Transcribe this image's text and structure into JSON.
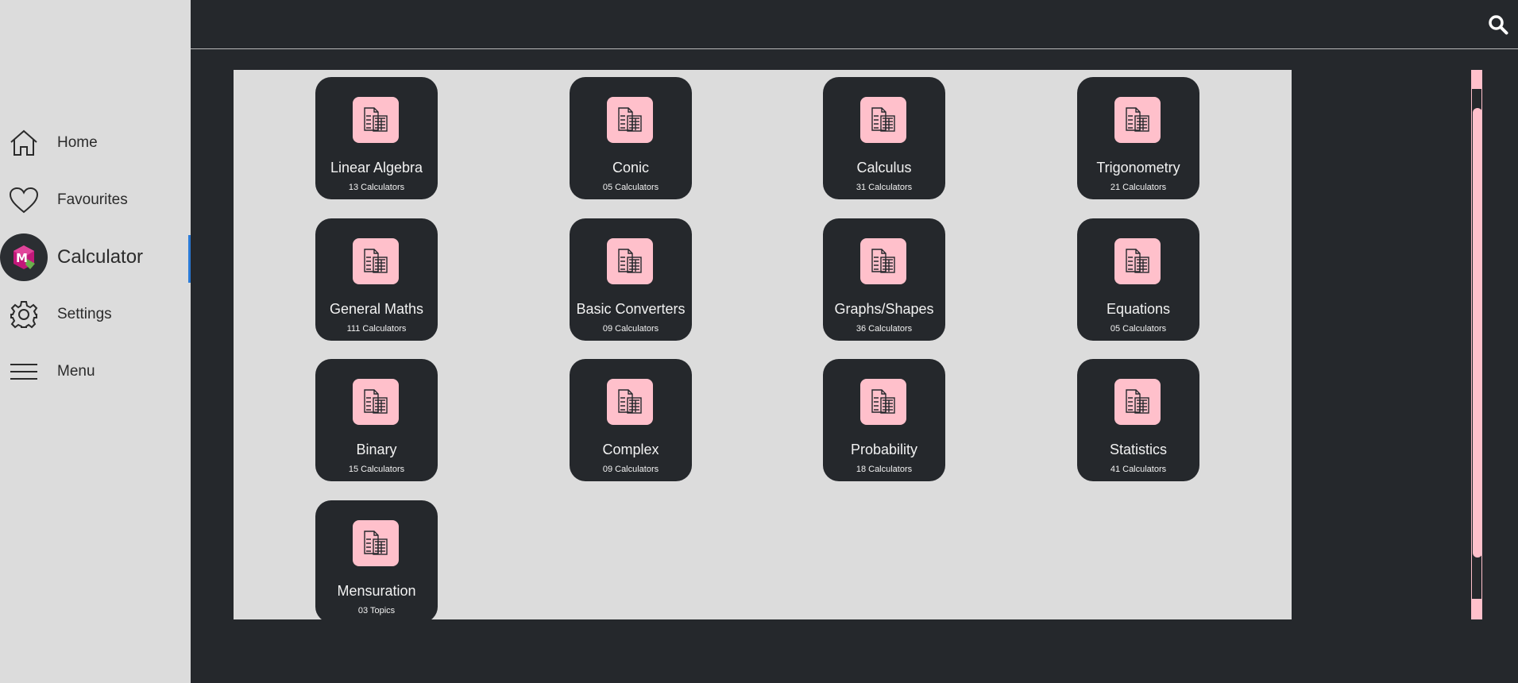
{
  "sidebar": {
    "items": [
      {
        "label": "Home",
        "icon": "home-icon"
      },
      {
        "label": "Favourites",
        "icon": "heart-icon"
      },
      {
        "label": "Calculator",
        "icon": "app-logo-icon",
        "active": true
      },
      {
        "label": "Settings",
        "icon": "gear-icon"
      },
      {
        "label": "Menu",
        "icon": "menu-icon"
      }
    ],
    "logo_text": "M"
  },
  "topbar": {
    "search_icon": "search-icon"
  },
  "categories": [
    {
      "title": "Linear Algebra",
      "subtitle": "13 Calculators"
    },
    {
      "title": "Conic",
      "subtitle": "05 Calculators"
    },
    {
      "title": "Calculus",
      "subtitle": "31 Calculators"
    },
    {
      "title": "Trigonometry",
      "subtitle": "21 Calculators"
    },
    {
      "title": "General Maths",
      "subtitle": "111 Calculators"
    },
    {
      "title": "Basic Converters",
      "subtitle": "09 Calculators"
    },
    {
      "title": "Graphs/Shapes",
      "subtitle": "36 Calculators"
    },
    {
      "title": "Equations",
      "subtitle": "05 Calculators"
    },
    {
      "title": "Binary",
      "subtitle": "15 Calculators"
    },
    {
      "title": "Complex",
      "subtitle": "09 Calculators"
    },
    {
      "title": "Probability",
      "subtitle": "18 Calculators"
    },
    {
      "title": "Statistics",
      "subtitle": "41 Calculators"
    },
    {
      "title": "Mensuration",
      "subtitle": "03 Topics"
    }
  ],
  "colors": {
    "accent": "#ffc0cb",
    "dark": "#25282c",
    "panel": "#dcdcdc",
    "active_marker": "#2a7ad6"
  }
}
